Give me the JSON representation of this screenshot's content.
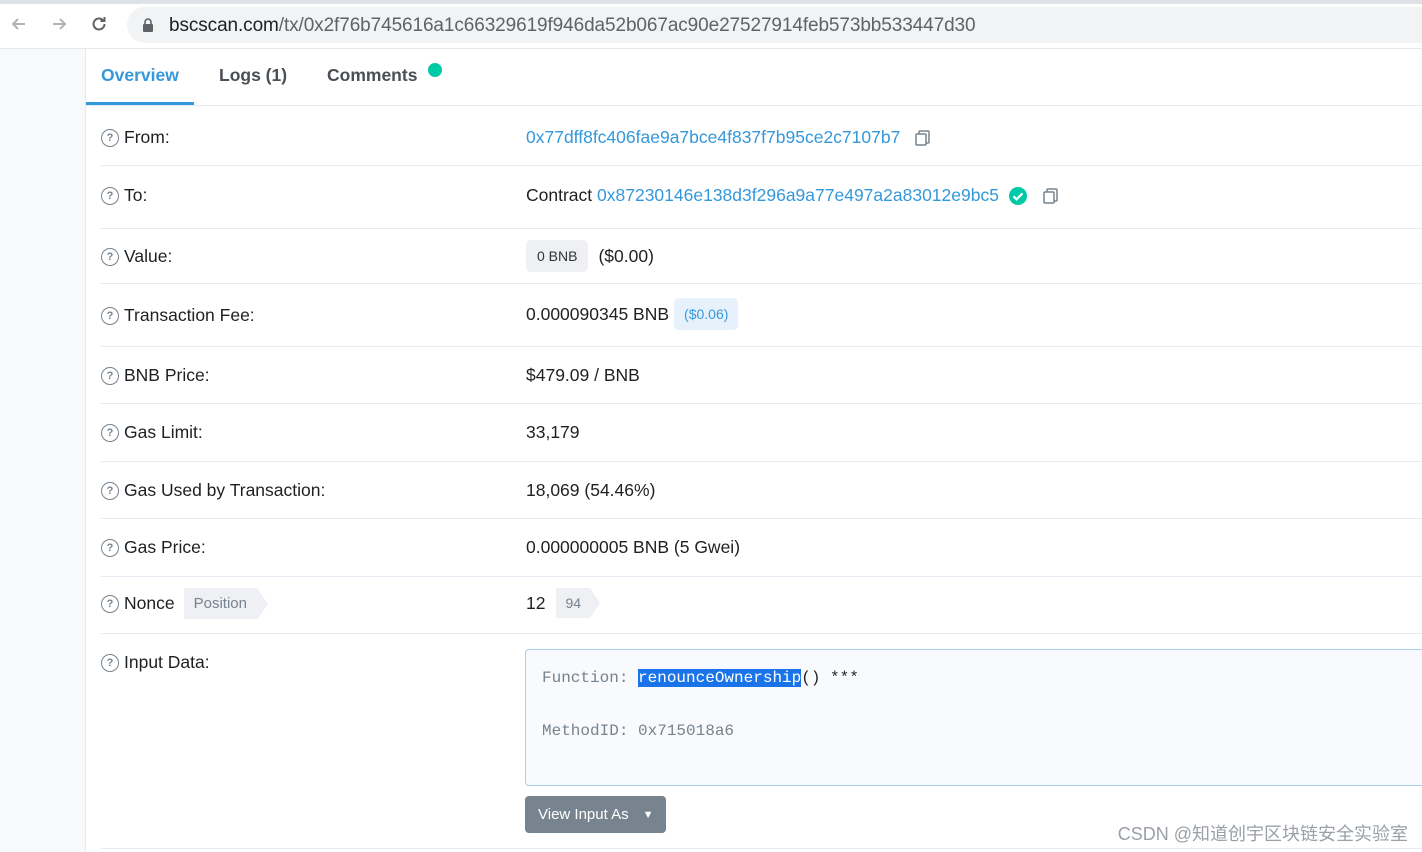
{
  "browser": {
    "url_host": "bscscan.com",
    "url_path": "/tx/0x2f76b745616a1c66329619f946da52b067ac90e27527914feb573bb533447d30"
  },
  "tabs": [
    {
      "label": "Overview"
    },
    {
      "label": "Logs (1)"
    },
    {
      "label": "Comments"
    }
  ],
  "rows": {
    "from": {
      "label": "From:",
      "address": "0x77dff8fc406fae9a7bce4f837f7b95ce2c7107b7"
    },
    "to": {
      "label": "To:",
      "prefix": "Contract",
      "address": "0x87230146e138d3f296a9a77e497a2a83012e9bc5"
    },
    "value": {
      "label": "Value:",
      "amount": "0 BNB",
      "usd": "($0.00)"
    },
    "fee": {
      "label": "Transaction Fee:",
      "amount": "0.000090345 BNB",
      "usd": "($0.06)"
    },
    "price": {
      "label": "BNB Price:",
      "value": "$479.09 / BNB"
    },
    "gas_limit": {
      "label": "Gas Limit:",
      "value": "33,179"
    },
    "gas_used": {
      "label": "Gas Used by Transaction:",
      "value": "18,069 (54.46%)"
    },
    "gas_price": {
      "label": "Gas Price:",
      "value": "0.000000005 BNB (5 Gwei)"
    },
    "nonce": {
      "label": "Nonce",
      "tag": "Position",
      "value": "12",
      "position": "94"
    },
    "input": {
      "label": "Input Data:",
      "function_prefix": "Function: ",
      "function_name": "renounceOwnership",
      "function_suffix": "() ***",
      "method_id": "MethodID: 0x715018a6",
      "button": "View Input As"
    }
  },
  "watermark": "CSDN @知道创宇区块链安全实验室",
  "colors": {
    "accent": "#3498db",
    "verified": "#00c9a7",
    "button": "#77838f"
  }
}
